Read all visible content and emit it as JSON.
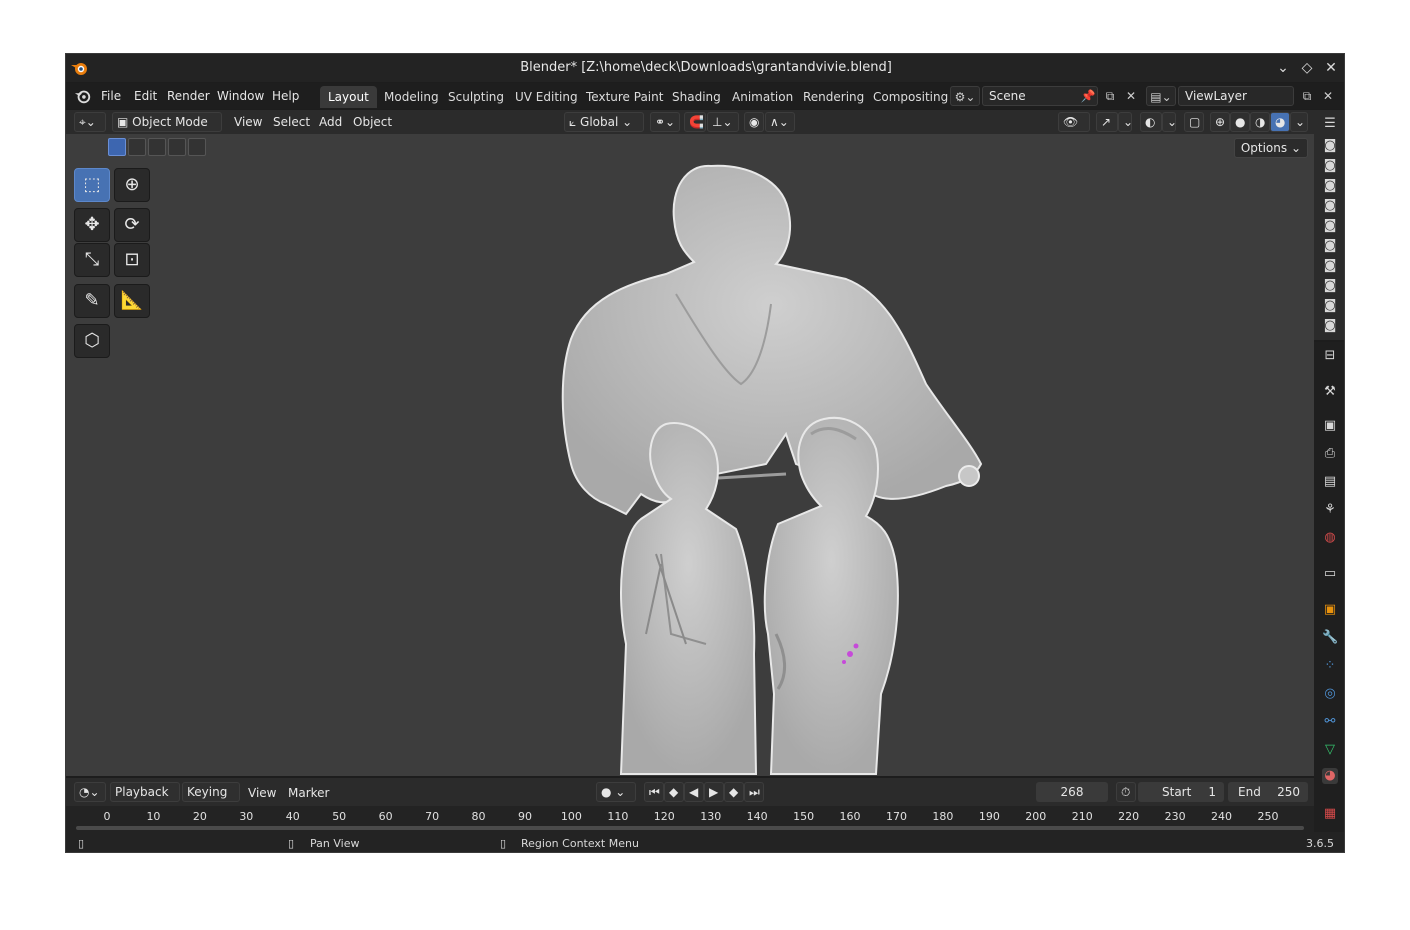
{
  "window": {
    "title": "Blender* [Z:\\home\\deck\\Downloads\\grantandvivie.blend]",
    "controls": [
      "chevron-down-icon",
      "restore-icon",
      "close-icon"
    ]
  },
  "menubar": {
    "menus": [
      "File",
      "Edit",
      "Render",
      "Window",
      "Help"
    ],
    "workspaces": [
      "Layout",
      "Modeling",
      "Sculpting",
      "UV Editing",
      "Texture Paint",
      "Shading",
      "Animation",
      "Rendering",
      "Compositing"
    ],
    "active_workspace": "Layout",
    "scene": "Scene",
    "view_layer": "ViewLayer"
  },
  "viewport_header": {
    "mode": "Object Mode",
    "menus": [
      "View",
      "Select",
      "Add",
      "Object"
    ],
    "orientation": "Global",
    "options_label": "Options"
  },
  "timeline": {
    "menus": [
      "Playback",
      "Keying",
      "View",
      "Marker"
    ],
    "current_frame": "268",
    "start_label": "Start",
    "start_value": "1",
    "end_label": "End",
    "end_value": "250",
    "ticks": [
      "0",
      "10",
      "20",
      "30",
      "40",
      "50",
      "60",
      "70",
      "80",
      "90",
      "100",
      "110",
      "120",
      "130",
      "140",
      "150",
      "160",
      "170",
      "180",
      "190",
      "200",
      "210",
      "220",
      "230",
      "240",
      "250"
    ]
  },
  "statusbar": {
    "pan_view": "Pan View",
    "region_menu": "Region Context Menu",
    "version": "3.6.5"
  },
  "colors": {
    "accent": "#4772b3",
    "viewport_bg": "#3d3d3d",
    "orange": "#e87d0d"
  }
}
